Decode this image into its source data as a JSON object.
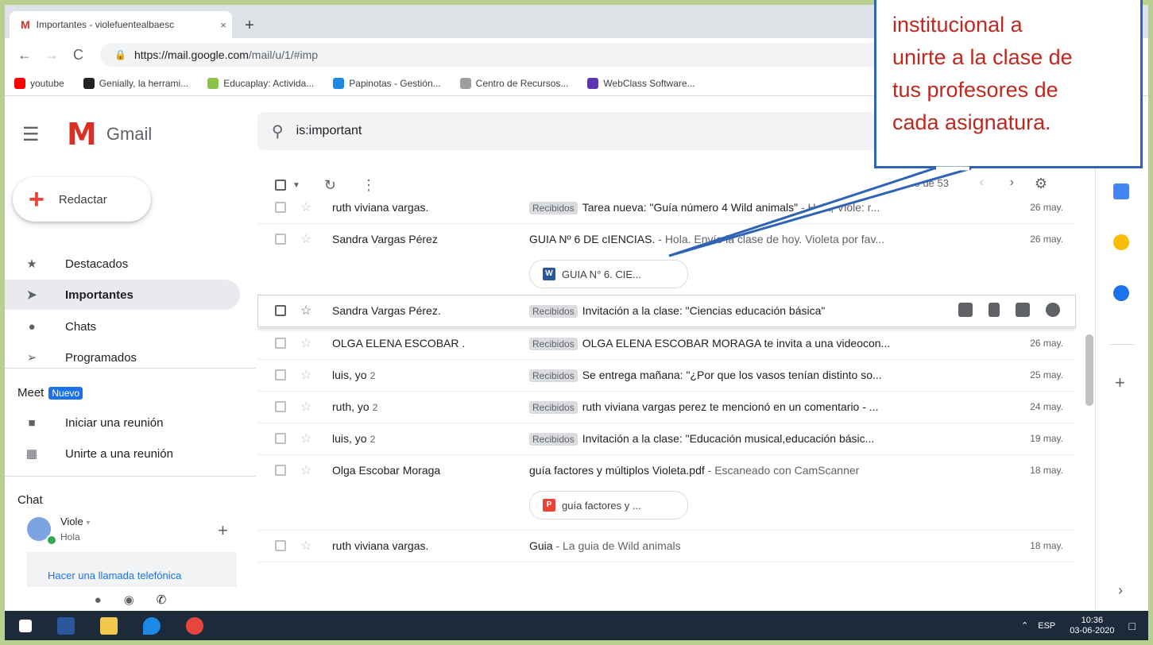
{
  "browser": {
    "tab_title": "Importantes - violefuentealbaesc",
    "tab_close": "×",
    "new_tab": "+",
    "url_host": "https://mail.google.com",
    "url_path": "/mail/u/1/#imp",
    "nav_back": "←",
    "nav_forward": "→",
    "nav_reload": "C",
    "bookmarks": [
      {
        "label": "youtube",
        "icon": "youtube-icon",
        "color": "#ff0000"
      },
      {
        "label": "Genially, la herrami...",
        "icon": "genially-icon",
        "color": "#222222"
      },
      {
        "label": "Educaplay: Activida...",
        "icon": "educaplay-icon",
        "color": "#8bc34a"
      },
      {
        "label": "Papinotas - Gestión...",
        "icon": "papinotas-icon",
        "color": "#1e88e5"
      },
      {
        "label": "Centro de Recursos...",
        "icon": "recursos-icon",
        "color": "#9e9e9e"
      },
      {
        "label": "WebClass Software...",
        "icon": "webclass-icon",
        "color": "#5e35b1"
      }
    ]
  },
  "gmail": {
    "logo_text": "Gmail",
    "search_value": "is:important",
    "compose_label": "Redactar",
    "nav": [
      {
        "label": "Destacados",
        "icon": "star-icon",
        "glyph": "★"
      },
      {
        "label": "Importantes",
        "icon": "important-icon",
        "glyph": "➤"
      },
      {
        "label": "Chats",
        "icon": "chat-icon",
        "glyph": "●"
      },
      {
        "label": "Programados",
        "icon": "scheduled-icon",
        "glyph": "➢"
      }
    ],
    "meet": {
      "title": "Meet",
      "badge": "Nuevo",
      "items": [
        {
          "label": "Iniciar una reunión",
          "icon": "video-icon",
          "glyph": "■"
        },
        {
          "label": "Unirte a una reunión",
          "icon": "keyboard-icon",
          "glyph": "▦"
        }
      ]
    },
    "chat": {
      "title": "Chat",
      "user_name": "Viole",
      "user_status": "Hola",
      "call_link": "Hacer una llamada telefónica"
    },
    "toolbar": {
      "pager": "1–50 de 53",
      "prev": "‹",
      "next": "›"
    },
    "emails": [
      {
        "sender": "ruth viviana vargas.",
        "count": "",
        "label": "Recibidos",
        "subject": "Tarea nueva: \"Guía número 4 Wild animals\"",
        "preview": " - Hola, Viole: r...",
        "date": "26 may."
      },
      {
        "sender": "Sandra Vargas Pérez",
        "count": "",
        "label": "",
        "subject": "GUIA Nº 6 DE cIENCIAS.",
        "preview": " - Hola. Envío la clase de hoy. Violeta por fav...",
        "date": "26 may.",
        "attachment": "GUIA N° 6. CIE..."
      },
      {
        "sender": "Sandra Vargas Pérez.",
        "count": "",
        "label": "Recibidos",
        "subject": "Invitación a la clase: \"Ciencias educación básica\"",
        "preview": "",
        "date": ""
      },
      {
        "sender": "OLGA ELENA ESCOBAR .",
        "count": "",
        "label": "Recibidos",
        "subject": "OLGA ELENA ESCOBAR MORAGA te invita a una videocon...",
        "preview": "",
        "date": "26 may."
      },
      {
        "sender": "luis, yo",
        "count": "2",
        "label": "Recibidos",
        "subject": "Se entrega mañana: \"¿Por que los vasos tenían distinto so...",
        "preview": "",
        "date": "25 may."
      },
      {
        "sender": "ruth, yo",
        "count": "2",
        "label": "Recibidos",
        "subject": "ruth viviana vargas perez te mencionó en un comentario - ...",
        "preview": "",
        "date": "24 may."
      },
      {
        "sender": "luis, yo",
        "count": "2",
        "label": "Recibidos",
        "subject": "Invitación a la clase: \"Educación musical,educación básic...",
        "preview": "",
        "date": "19 may."
      },
      {
        "sender": "Olga Escobar Moraga",
        "count": "",
        "label": "",
        "subject": "guía factores y múltiplos Violeta.pdf",
        "preview": " - Escaneado con CamScanner",
        "date": "18 may.",
        "attachment": "guía factores y ..."
      },
      {
        "sender": "ruth viviana vargas.",
        "count": "",
        "label": "",
        "subject": "Guia",
        "preview": " - La guia de Wild animals",
        "date": "18 may."
      }
    ]
  },
  "taskbar": {
    "lang": "ESP",
    "time": "10:36",
    "date": "03-06-2020"
  },
  "callout": {
    "lines": [
      "institucional a",
      "unirte a la clase de",
      "tus profesores de",
      "cada asignatura."
    ]
  },
  "colors": {
    "callout_border": "#2e63b6",
    "callout_text": "#c0281f",
    "gmail_red": "#d93025",
    "frame_bg": "#b9cf8f"
  }
}
